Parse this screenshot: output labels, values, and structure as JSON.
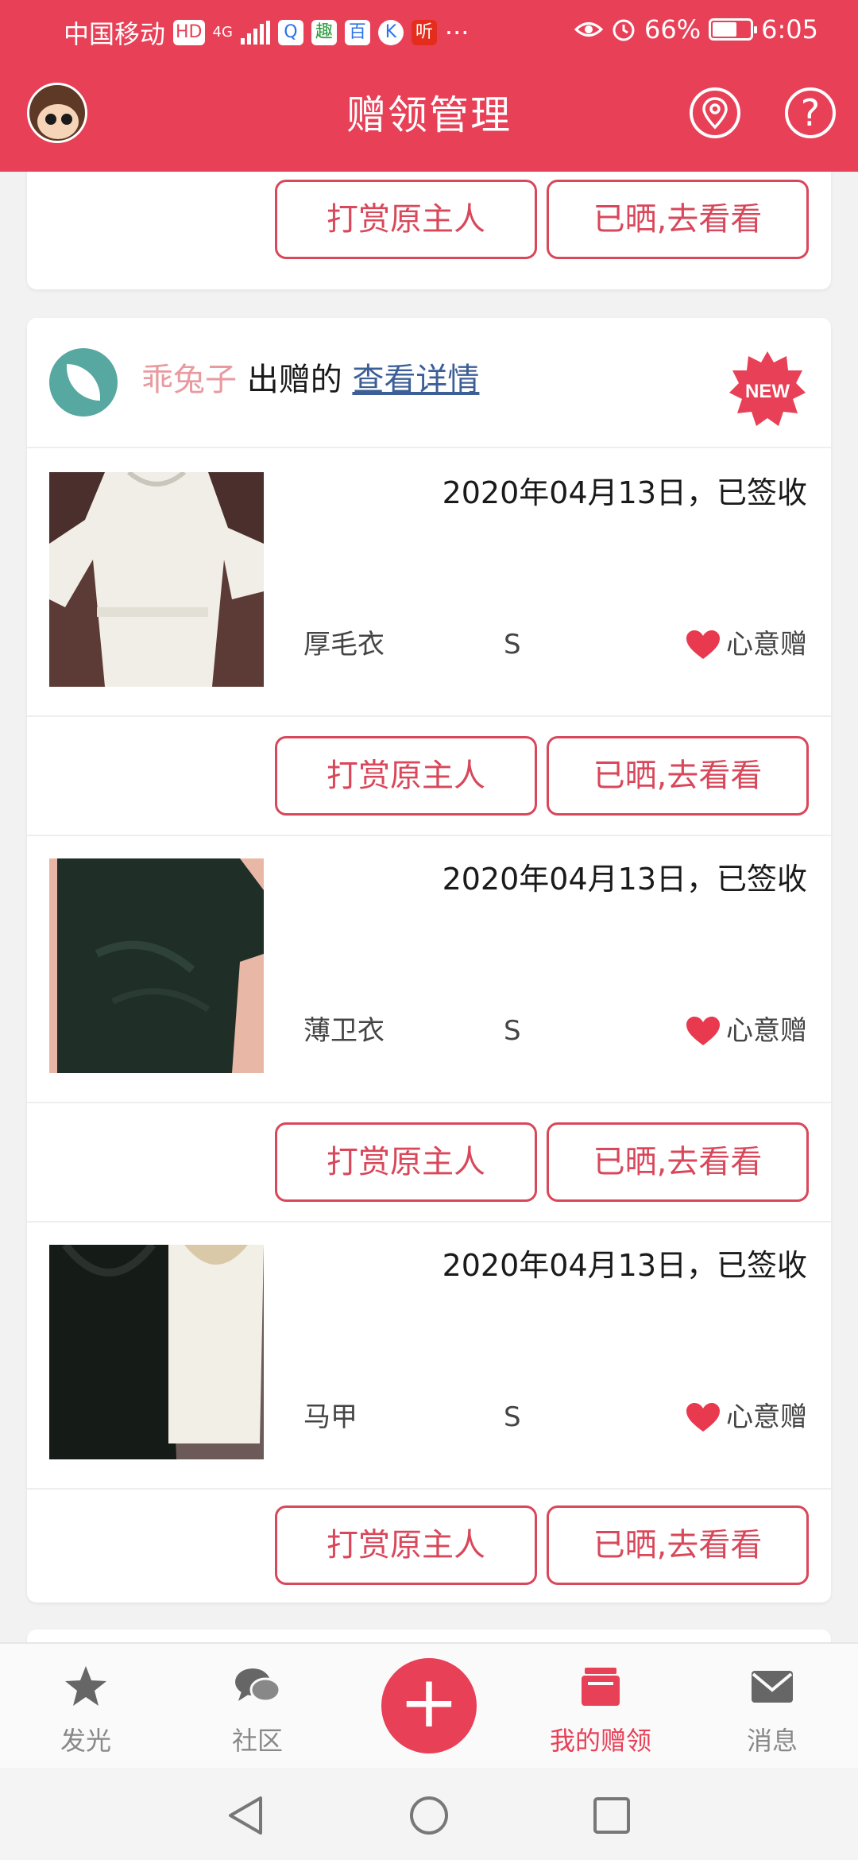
{
  "status_bar": {
    "carrier": "中国移动",
    "hd": "HD",
    "network": "4G",
    "app_icons": [
      "Q",
      "趣",
      "百",
      "K",
      "听"
    ],
    "more": "···",
    "battery": "66%",
    "time": "6:05"
  },
  "header": {
    "title": "赠领管理"
  },
  "top_card": {
    "buttons": [
      "打赏原主人",
      "已晒,去看看"
    ]
  },
  "giver_card": {
    "giver_name": "乖兔子",
    "giver_suffix": "出赠的",
    "detail_link": "查看详情",
    "badge": "NEW",
    "items": [
      {
        "date_status": "2020年04月13日，已签收",
        "name": "厚毛衣",
        "size": "S",
        "type": "心意赠",
        "buttons": [
          "打赏原主人",
          "已晒,去看看"
        ]
      },
      {
        "date_status": "2020年04月13日，已签收",
        "name": "薄卫衣",
        "size": "S",
        "type": "心意赠",
        "buttons": [
          "打赏原主人",
          "已晒,去看看"
        ]
      },
      {
        "date_status": "2020年04月13日，已签收",
        "name": "马甲",
        "size": "S",
        "type": "心意赠",
        "buttons": [
          "打赏原主人",
          "已晒,去看看"
        ]
      }
    ]
  },
  "bottom_nav": {
    "items": [
      {
        "label": "发光",
        "icon": "star-icon"
      },
      {
        "label": "社区",
        "icon": "chat-bubbles-icon"
      },
      {
        "label": "我的赠领",
        "icon": "gift-box-icon",
        "active": true
      },
      {
        "label": "消息",
        "icon": "mail-icon"
      }
    ],
    "fab": "+"
  },
  "colors": {
    "primary": "#e84057",
    "button_border": "#d8475a",
    "giver_name": "#e89a9f",
    "link": "#3d5f97"
  }
}
